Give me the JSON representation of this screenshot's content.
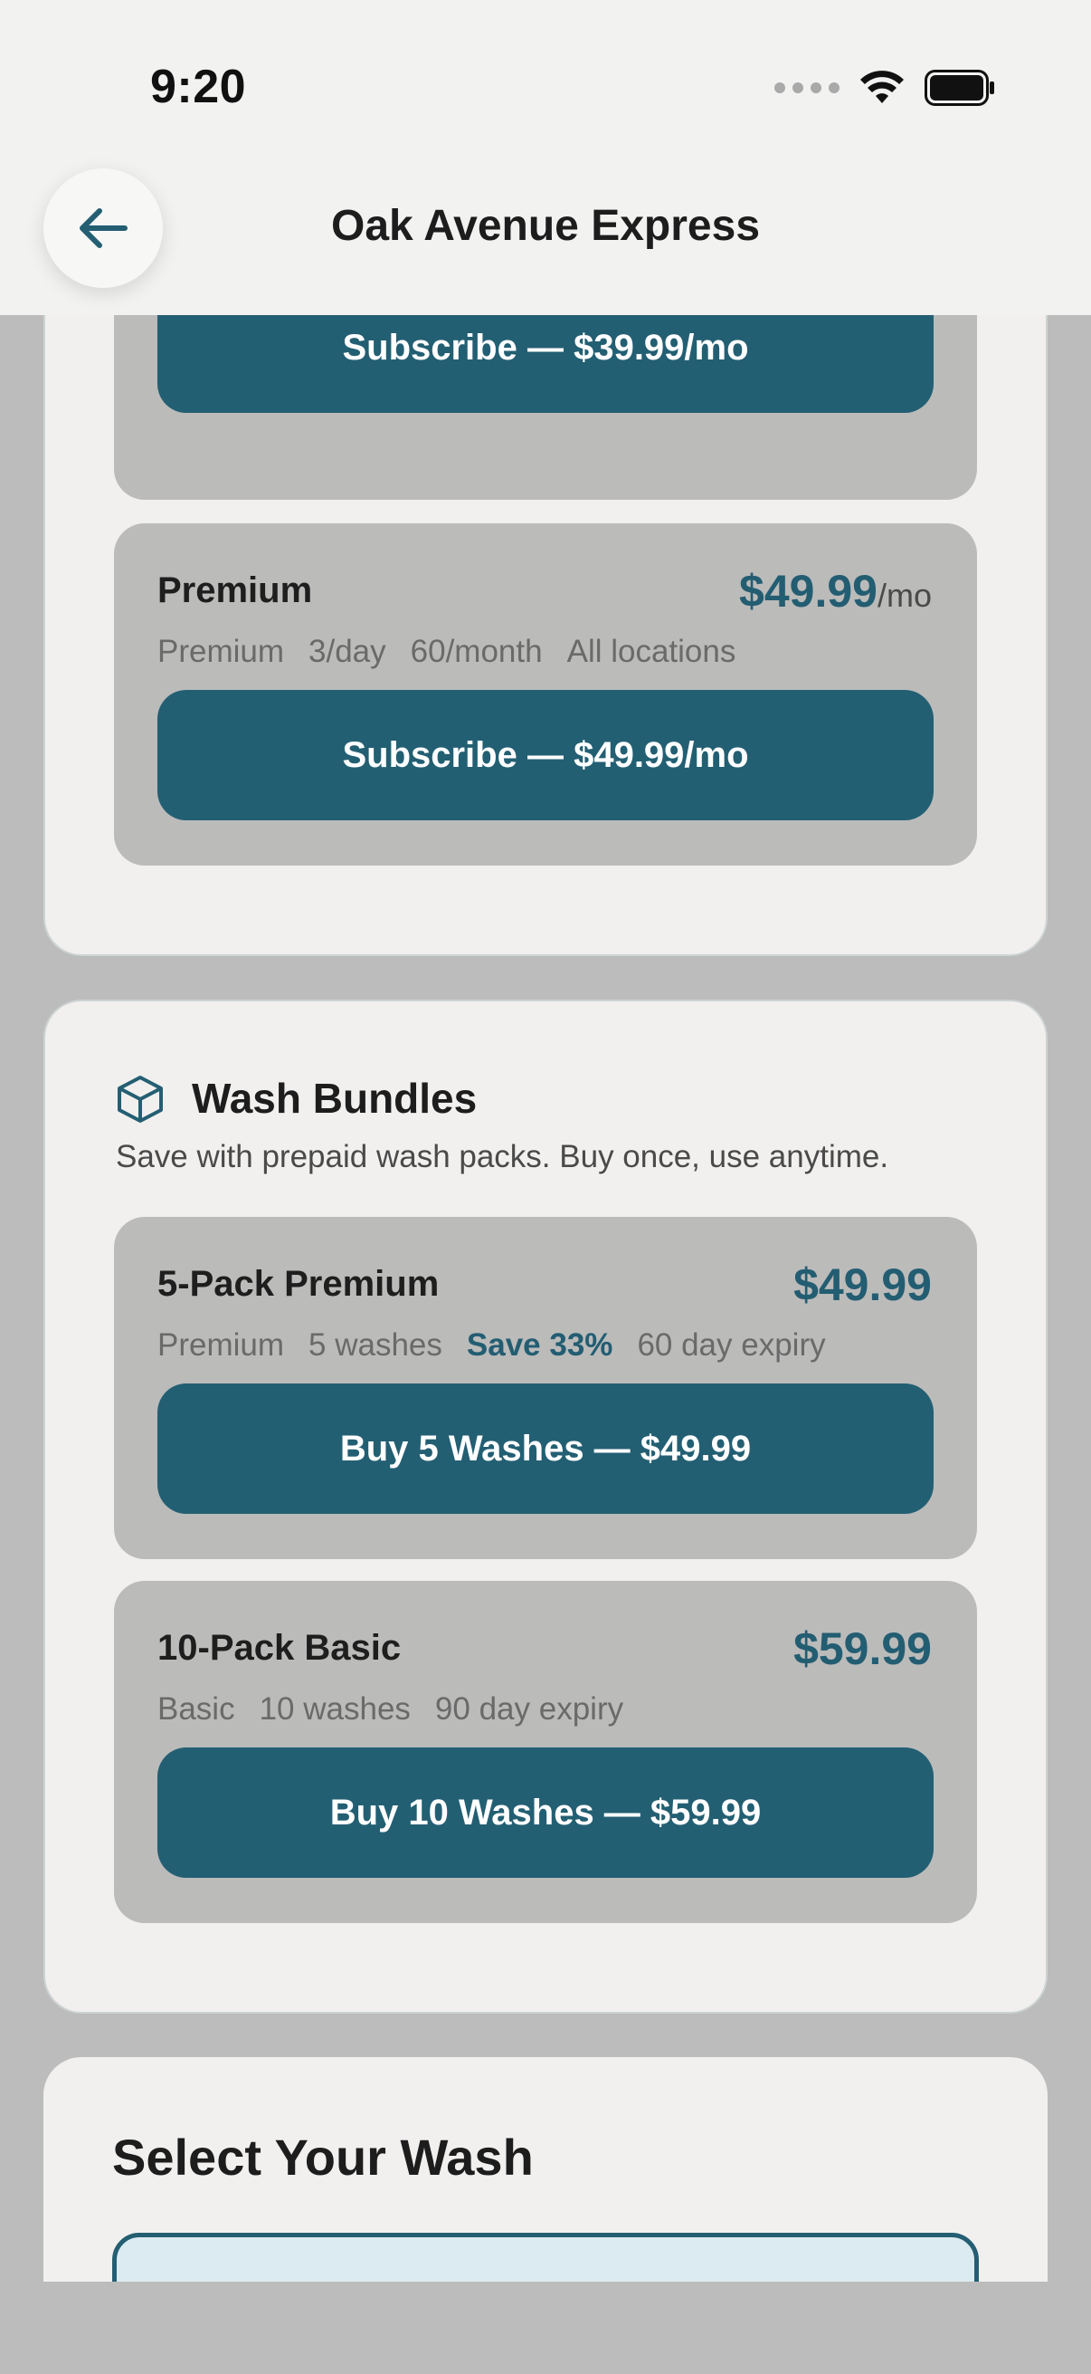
{
  "status_bar": {
    "time": "9:20"
  },
  "header": {
    "title": "Oak Avenue Express"
  },
  "subscriptions": {
    "previous_plan_button": "Subscribe — $39.99/mo",
    "premium": {
      "name": "Premium",
      "price": "$49.99",
      "per": "/mo",
      "tags": [
        "Premium",
        "3/day",
        "60/month",
        "All locations"
      ],
      "button": "Subscribe — $49.99/mo"
    }
  },
  "bundles": {
    "title": "Wash Bundles",
    "description": "Save with prepaid wash packs. Buy once, use anytime.",
    "items": [
      {
        "name": "5-Pack Premium",
        "price": "$49.99",
        "tags": [
          "Premium",
          "5 washes"
        ],
        "save": "Save 33%",
        "expiry": "60 day expiry",
        "button": "Buy 5 Washes — $49.99"
      },
      {
        "name": "10-Pack Basic",
        "price": "$59.99",
        "tags": [
          "Basic",
          "10 washes",
          "90 day expiry"
        ],
        "button": "Buy 10 Washes — $59.99"
      }
    ]
  },
  "select_wash": {
    "title": "Select Your Wash"
  },
  "colors": {
    "accent": "#235f73",
    "card_bg": "#f1f0ef",
    "item_bg": "#bbbbba",
    "page_bg": "#bbbcbb"
  }
}
